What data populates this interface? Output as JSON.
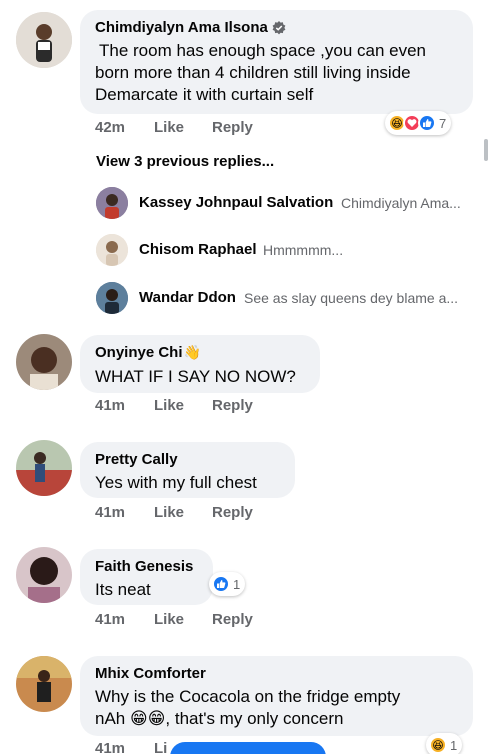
{
  "comments": [
    {
      "name": "Chimdiyalyn Ama Ilsona",
      "text_lines": [
        "The room has enough space ,you can even",
        "born more than 4 children still living inside",
        "Demarcate it with curtain self"
      ],
      "time": "42m",
      "like": "Like",
      "reply": "Reply",
      "reaction_count": "7",
      "reaction_icons": [
        "haha-icon",
        "love-icon",
        "like-icon"
      ]
    },
    {
      "name": "Onyinye Chi",
      "name_emoji": "👋",
      "text": "WHAT IF I SAY NO NOW?",
      "time": "41m",
      "like": "Like",
      "reply": "Reply"
    },
    {
      "name": "Pretty Cally",
      "text": "Yes with my full chest",
      "time": "41m",
      "like": "Like",
      "reply": "Reply"
    },
    {
      "name": "Faith Genesis",
      "text": "Its neat",
      "time": "41m",
      "like": "Like",
      "reply": "Reply",
      "reaction_count": "1",
      "reaction_icons": [
        "like-icon"
      ]
    },
    {
      "name": "Mhix Comforter",
      "text_lines": [
        "Why is the Cocacola on the fridge empty",
        "nAh 😁😁, that's my only concern"
      ],
      "time": "41m",
      "like": "Li",
      "reaction_count": "1",
      "reaction_icons": [
        "haha-icon"
      ]
    }
  ],
  "view_previous_replies": "View 3 previous replies...",
  "replies": [
    {
      "name": "Kassey Johnpaul Salvation",
      "snippet": "Chimdiyalyn Ama..."
    },
    {
      "name": "Chisom Raphael",
      "snippet": "Hmmmmm..."
    },
    {
      "name": "Wandar Ddon",
      "snippet": "See as slay queens dey blame a..."
    }
  ],
  "colors": {
    "accent": "#1877f2",
    "bubble": "#f0f2f5",
    "meta_text": "#65676b",
    "verified_badge": "#65676b"
  }
}
